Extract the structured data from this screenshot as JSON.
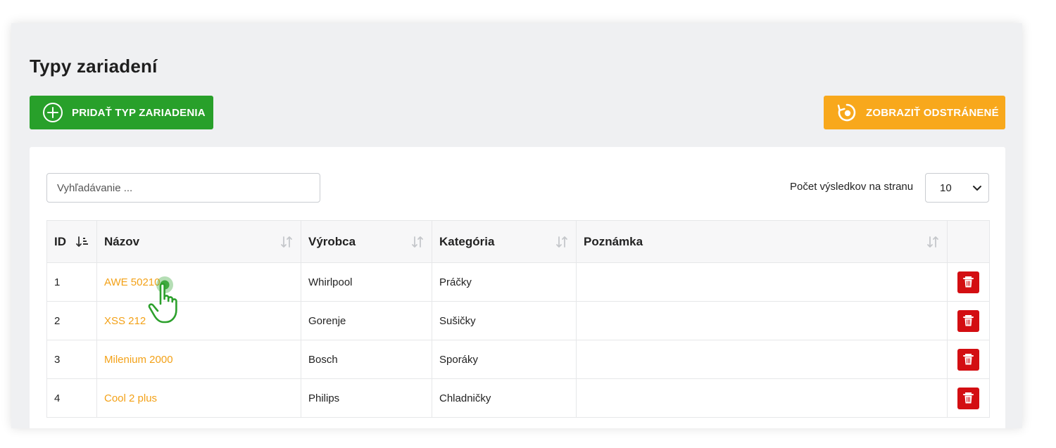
{
  "page": {
    "title": "Typy zariadení"
  },
  "toolbar": {
    "add_label": "PRIDAŤ TYP ZARIADENIA",
    "show_deleted_label": "ZOBRAZIŤ ODSTRÁNENÉ"
  },
  "search": {
    "placeholder": "Vyhľadávanie ..."
  },
  "pagination": {
    "label": "Počet výsledkov na stranu",
    "selected": "10"
  },
  "table": {
    "headers": {
      "id": "ID",
      "name": "Názov",
      "manufacturer": "Výrobca",
      "category": "Kategória",
      "note": "Poznámka"
    },
    "rows": [
      {
        "id": "1",
        "name": "AWE 50210",
        "manufacturer": "Whirlpool",
        "category": "Práčky",
        "note": ""
      },
      {
        "id": "2",
        "name": "XSS 212",
        "manufacturer": "Gorenje",
        "category": "Sušičky",
        "note": ""
      },
      {
        "id": "3",
        "name": "Milenium 2000",
        "manufacturer": "Bosch",
        "category": "Sporáky",
        "note": ""
      },
      {
        "id": "4",
        "name": "Cool 2 plus",
        "manufacturer": "Philips",
        "category": "Chladničky",
        "note": ""
      }
    ]
  },
  "icons": {
    "add": "plus-circle-icon",
    "show_deleted": "restore-icon",
    "sort": "sort-icon",
    "delete": "trash-icon",
    "cursor": "hand-pointer-icon"
  },
  "colors": {
    "primary": "#28a02a",
    "warning": "#f8a81c",
    "link": "#f3a117",
    "danger": "#d30e12",
    "background": "#eff0f2"
  }
}
